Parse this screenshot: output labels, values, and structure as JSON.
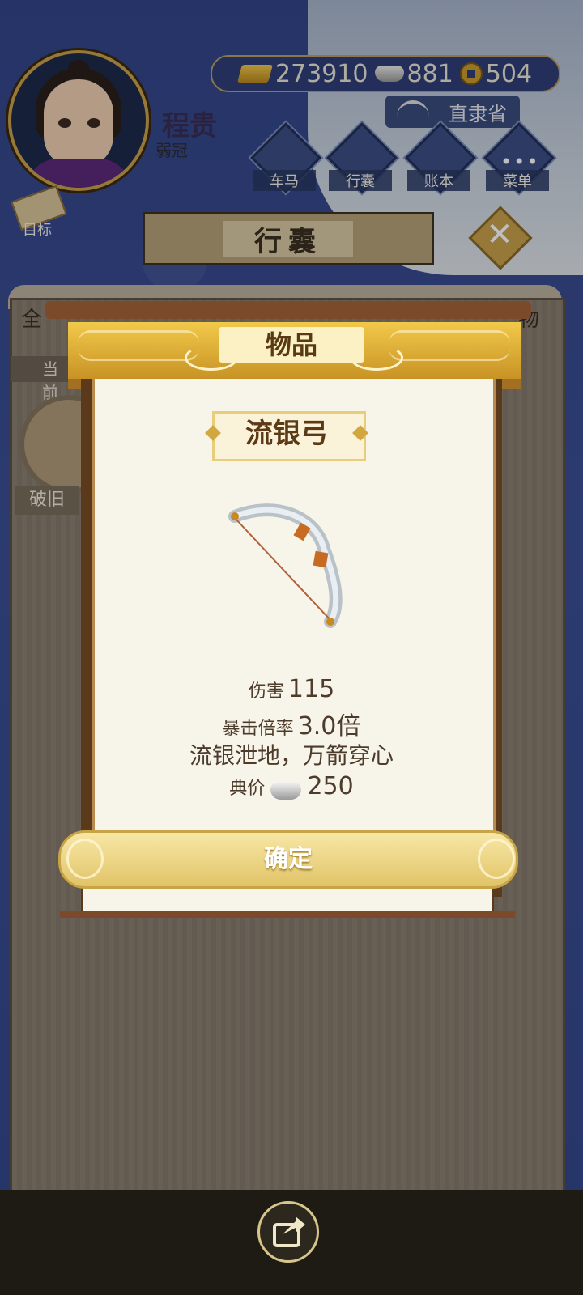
{
  "player": {
    "name": "程贵",
    "title": "弱冠"
  },
  "currency": {
    "gold": "273910",
    "silver": "881",
    "coins": "504"
  },
  "location": "直隶省",
  "nav": {
    "items": [
      {
        "label": "车马"
      },
      {
        "label": "行囊"
      },
      {
        "label": "账本"
      },
      {
        "label": "菜单"
      }
    ],
    "goal_label": "目标"
  },
  "screen_title": "行囊",
  "behind": {
    "tab_left": "全",
    "tab_right": "物",
    "current_label": "当前",
    "item_label": "破旧"
  },
  "modal": {
    "header": "物品",
    "item_name": "流银弓",
    "damage_label": "伤害",
    "damage_value": "115",
    "crit_label": "暴击倍率",
    "crit_value": "3.0倍",
    "description": "流银泄地，万箭穿心",
    "price_label": "典价",
    "price_value": "250",
    "confirm": "确定"
  },
  "colors": {
    "accent_gold": "#c9a24b",
    "panel_blue": "#2f3f78",
    "paper": "#f7f5ea"
  },
  "icons": [
    "gold-bar-icon",
    "silver-ingot-icon",
    "coin-icon",
    "ship-icon",
    "carriage-icon",
    "bag-icon",
    "ledger-icon",
    "menu-icon",
    "scroll-icon",
    "close-icon",
    "bow-icon",
    "share-icon"
  ]
}
